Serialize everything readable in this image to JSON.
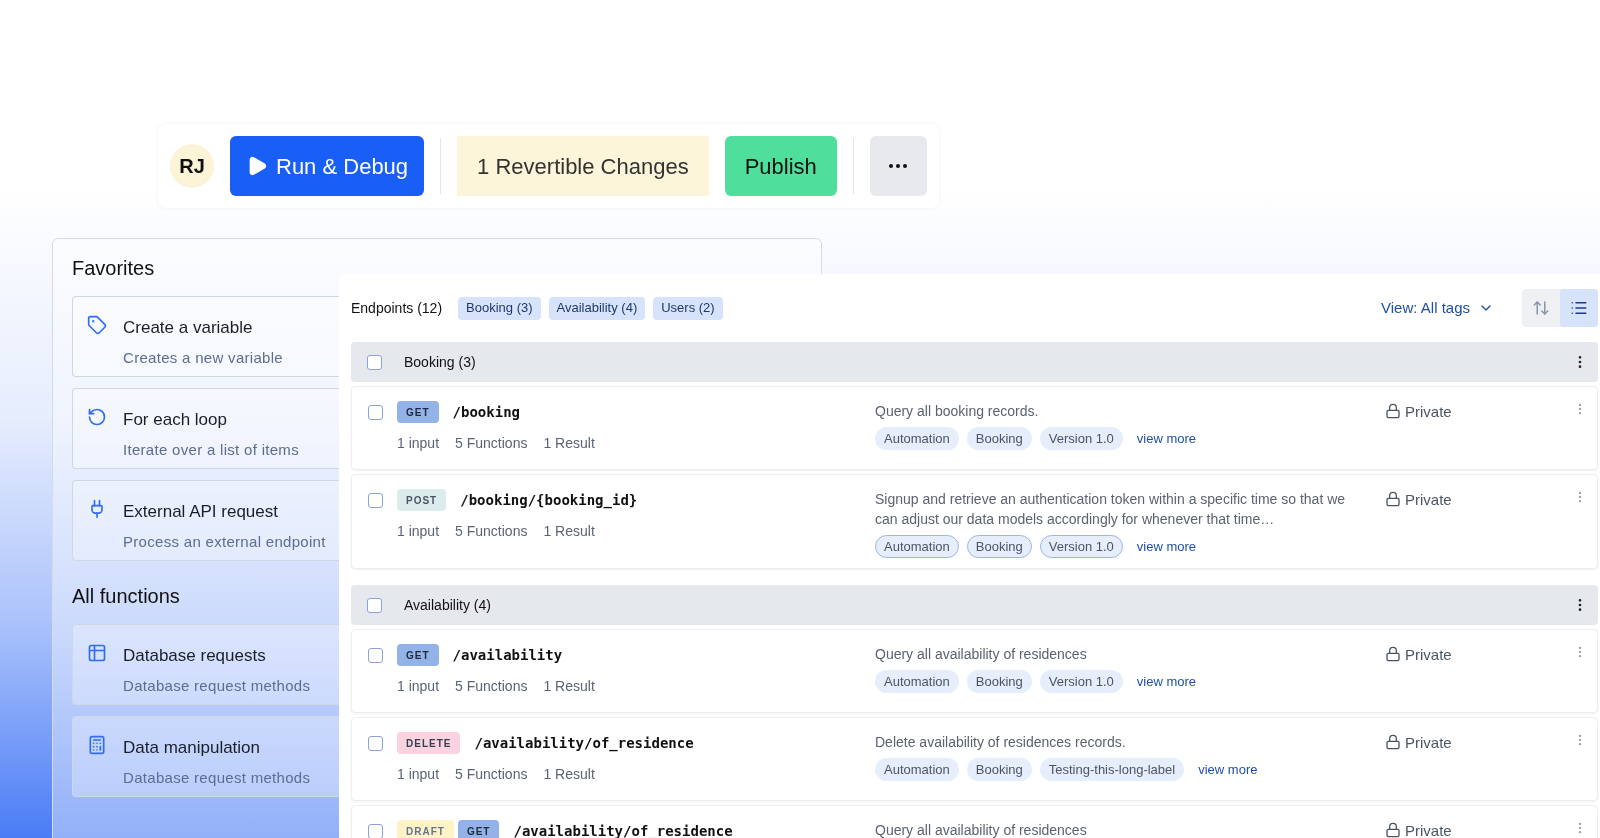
{
  "toolbar": {
    "avatar": "RJ",
    "run_button": "Run & Debug",
    "changes_button": "1 Revertible Changes",
    "publish_button": "Publish"
  },
  "left_panel": {
    "sections": [
      {
        "title": "Favorites",
        "items": [
          {
            "kind": "tag",
            "title": "Create a variable",
            "subtitle": "Creates a new variable"
          },
          {
            "kind": "loop",
            "title": "For each loop",
            "subtitle": "Iterate over a list of items"
          },
          {
            "kind": "plug",
            "title": "External API request",
            "subtitle": "Process an external endpoint"
          }
        ]
      },
      {
        "title": "All functions",
        "items": [
          {
            "kind": "table",
            "title": "Database requests",
            "subtitle": "Database request methods"
          },
          {
            "kind": "calculator",
            "title": "Data manipulation",
            "subtitle": "Database request methods"
          }
        ]
      }
    ]
  },
  "endpoints": {
    "title": "Endpoints (12)",
    "filters": [
      "Booking (3)",
      "Availability (4)",
      "Users (2)"
    ],
    "view": "View: All tags",
    "view_toggle": [
      {
        "kind": "compact",
        "selected": false
      },
      {
        "kind": "list",
        "selected": true
      }
    ],
    "groups": [
      {
        "name": "Booking (3)",
        "checked": false,
        "items": [
          {
            "checked": false,
            "methods": [
              {
                "kind": "get",
                "label": "GET"
              }
            ],
            "path": "/booking",
            "meta": [
              "1 input",
              "5 Functions",
              "1 Result"
            ],
            "description": "Query all booking records.",
            "tags": [
              "Automation",
              "Booking",
              "Version 1.0"
            ],
            "outlined": false,
            "more": "view more",
            "visibility": "Private"
          },
          {
            "checked": false,
            "methods": [
              {
                "kind": "post",
                "label": "POST"
              }
            ],
            "path": "/booking/{booking_id}",
            "meta": [
              "1 input",
              "5 Functions",
              "1 Result"
            ],
            "description": "Signup and retrieve an authentication token within a specific time so that we can adjust our data models accordingly for whenever that time…",
            "tags": [
              "Automation",
              "Booking",
              "Version 1.0"
            ],
            "outlined": true,
            "more": "view more",
            "visibility": "Private"
          }
        ]
      },
      {
        "name": "Availability (4)",
        "checked": false,
        "items": [
          {
            "checked": false,
            "methods": [
              {
                "kind": "get",
                "label": "GET"
              }
            ],
            "path": "/availability",
            "meta": [
              "1 input",
              "5 Functions",
              "1 Result"
            ],
            "description": "Query all availability of residences",
            "tags": [
              "Automation",
              "Booking",
              "Version 1.0"
            ],
            "outlined": false,
            "more": "view more",
            "visibility": "Private"
          },
          {
            "checked": false,
            "methods": [
              {
                "kind": "delete",
                "label": "DELETE"
              }
            ],
            "path": "/availability/of_residence",
            "meta": [
              "1 input",
              "5 Functions",
              "1 Result"
            ],
            "description": "Delete availability of residences records.",
            "tags": [
              "Automation",
              "Booking",
              "Testing-this-long-label"
            ],
            "outlined": false,
            "more": "view more",
            "visibility": "Private"
          },
          {
            "checked": false,
            "methods": [
              {
                "kind": "draft",
                "label": "DRAFT"
              },
              {
                "kind": "get",
                "label": "GET"
              }
            ],
            "path": "/availability/of_residence",
            "description": "Query all availability of residences",
            "visibility": "Private"
          }
        ]
      }
    ]
  }
}
